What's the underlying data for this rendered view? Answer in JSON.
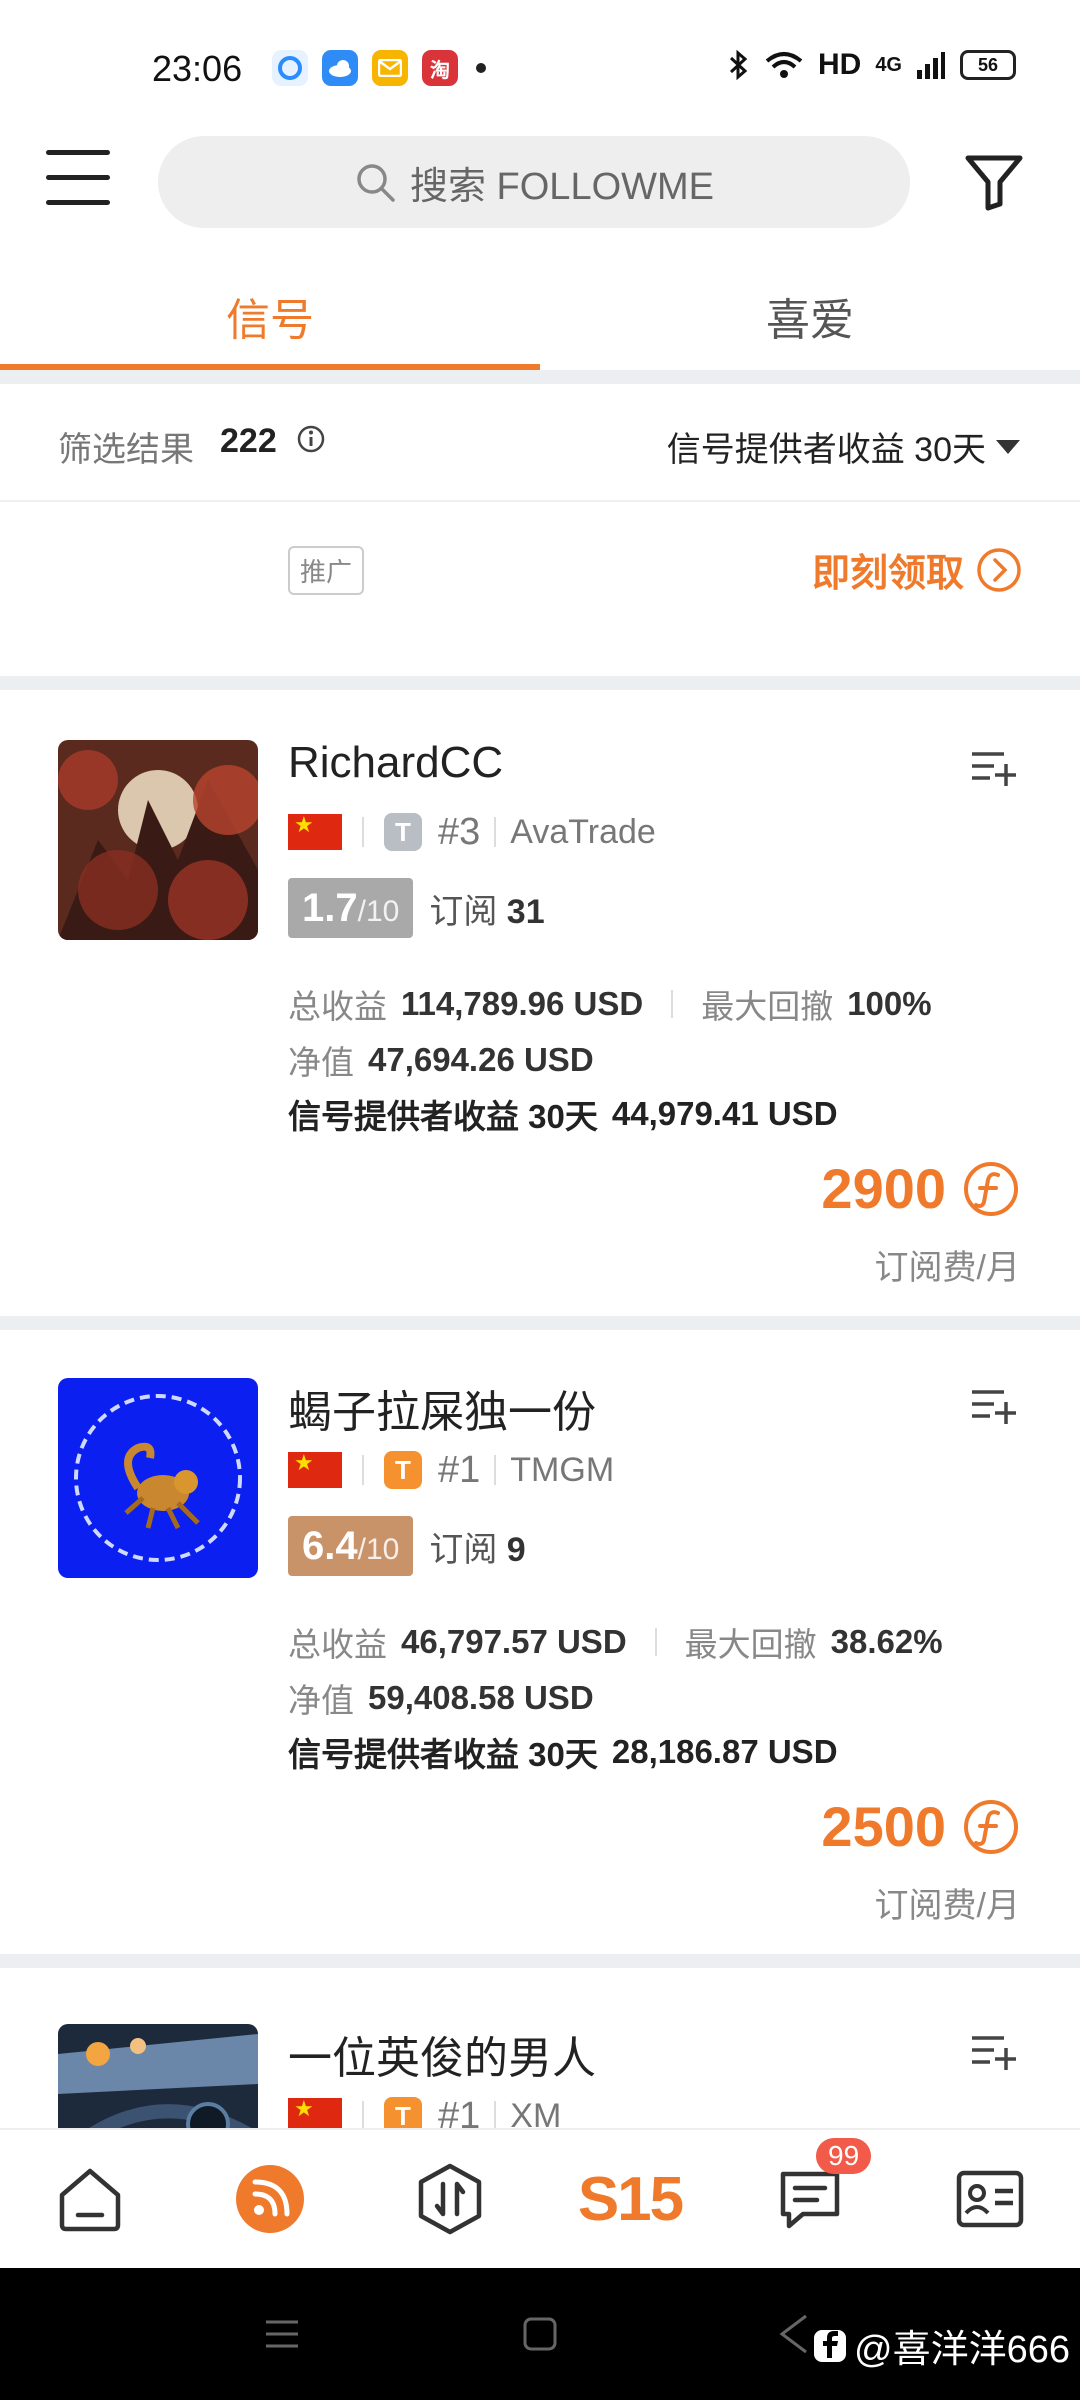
{
  "status_bar": {
    "time": "23:06",
    "network": "HD",
    "signal": "4G",
    "battery": "56"
  },
  "header": {
    "search_placeholder": "搜索 FOLLOWME"
  },
  "tabs": [
    {
      "label": "信号",
      "active": true
    },
    {
      "label": "喜爱",
      "active": false
    }
  ],
  "filter": {
    "label": "筛选结果",
    "count": "222",
    "sort_label": "信号提供者收益 30天"
  },
  "promo": {
    "tag": "推广",
    "cta": "即刻领取"
  },
  "accent_color": "#f07a2c",
  "cards": [
    {
      "name": "RichardCC",
      "badge_letter": "T",
      "badge_color": "#b8bec4",
      "rank": "#3",
      "broker": "AvaTrade",
      "score": "1.7",
      "score_max": "/10",
      "score_color": "#a9a9a9",
      "subs_label": "订阅",
      "subs_count": "31",
      "total_label": "总收益",
      "total_value": "114,789.96 USD",
      "drawdown_label": "最大回撤",
      "drawdown_value": "100%",
      "equity_label": "净值",
      "equity_value": "47,694.26 USD",
      "provider_label": "信号提供者收益 30天",
      "provider_value": "44,979.41 USD",
      "price": "2900",
      "price_unit": "订阅费/月"
    },
    {
      "name": "蝎子拉屎独一份",
      "badge_letter": "T",
      "badge_color": "#f5922f",
      "rank": "#1",
      "broker": "TMGM",
      "score": "6.4",
      "score_max": "/10",
      "score_color": "#c9936a",
      "subs_label": "订阅",
      "subs_count": "9",
      "total_label": "总收益",
      "total_value": "46,797.57 USD",
      "drawdown_label": "最大回撤",
      "drawdown_value": "38.62%",
      "equity_label": "净值",
      "equity_value": "59,408.58 USD",
      "provider_label": "信号提供者收益 30天",
      "provider_value": "28,186.87 USD",
      "price": "2500",
      "price_unit": "订阅费/月"
    },
    {
      "name": "一位英俊的男人",
      "badge_letter": "T",
      "badge_color": "#f5922f",
      "rank": "#1",
      "broker": "XM"
    }
  ],
  "bottom_nav": {
    "items": [
      "home-icon",
      "feed-icon",
      "trade-icon",
      "s15-logo",
      "messages-icon",
      "profile-card-icon"
    ],
    "s15_label": "S15",
    "messages_badge": "99"
  },
  "watermark": "@喜洋洋666"
}
